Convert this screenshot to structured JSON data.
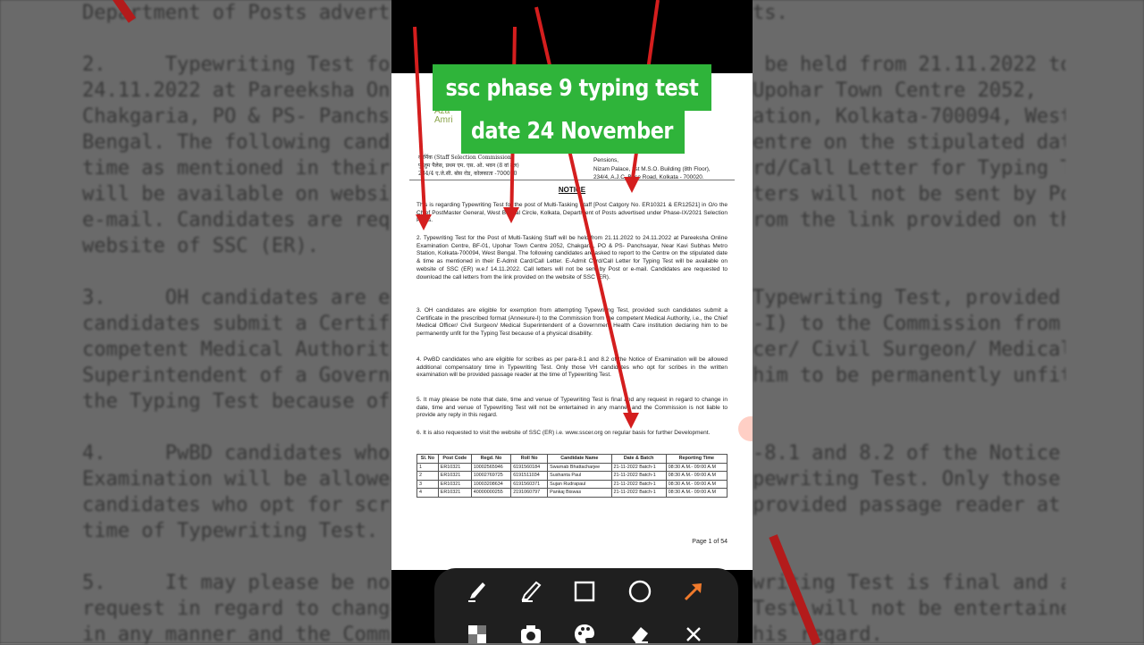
{
  "overlay_title": {
    "line1": "ssc phase 9 typing test",
    "line2": "date 24 November"
  },
  "document": {
    "logo_text": "Aza\nAmri",
    "header_left": [
      "कार्मिक (Staff Selection Commission)",
      "पु.जुम पैलेस, प्रथम एम. एस. ओ. भवन (8 वां तल)",
      "234/4 ए.जे.सी. बोस रोड, कोलकाता -700020"
    ],
    "header_right": [
      "R)",
      "Grievances &",
      "Pensions,",
      "Nizam Palace, 1st M.S.O. Building (8th Floor),",
      "234/4, A.J.C. Bose Road, Kolkata - 700020."
    ],
    "notice_heading": "NOTICE",
    "paragraphs": [
      "This is regarding Typewriting Test for the post of Multi-Tasking Staff [Post Catgory No. ER10321 & ER12521] in O/o the Chief PostMaster General, West Bengal Circle, Kolkata, Department of Posts advertised under Phase-IX/2021 Selection Posts.",
      "2.     Typewriting Test for the Post of Multi-Tasking Staff will be held from 21.11.2022 to 24.11.2022 at Pareeksha Online Examination Centre, BF-01, Upohar Town Centre 2052, Chakgaria, PO & PS- Panchsayar, Near Kavi Subhas Metro Station, Kolkata-700094, West Bengal. The following candidates are asked to report to the Centre on the stipulated date & time as mentioned in their E-Admit Card/Call Letter. E-Admit Card/Call Letter for Typing Test will be available on website of SSC (ER) w.e.f 14.11.2022. Call letters will not be sent by Post or e-mail. Candidates are requested to download the call letters from the link provided on the website of SSC (ER).",
      "3.     OH candidates are eligible for exemption from attempting Typewriting Test, provided such candidates submit a Certificate in the prescribed format (Annexure-I) to the Commission from the competent Medical Authority, i.e., the Chief Medical Officer/ Civil Surgeon/ Medical Superintendent of a Government Health Care institution declaring him to be permanently unfit for the Typing Test because of a physical disability.",
      "4.     PwBD candidates who are eligible for scribes as per para-8.1 and 8.2 of the Notice of Examination will be allowed additional compensatory time in Typewriting Test. Only those VH candidates who opt for scribes in the written examination will be provided passage reader at the time of Typewriting Test.",
      "5.     It may please be note that date, time and venue of Typewriting Test is final and any request in regard to change in date, time and venue of Typewriting Test will not be entertained in any manner and the Commission is not liable to provide any reply in this regard.",
      "6.     It is also requested to visit the website of SSC (ER) i.e. www.sscer.org on regular basis for further Development."
    ],
    "table": {
      "headers": [
        "Sl. No",
        "Post Code",
        "Regd. No",
        "Roll No",
        "Candidate Name",
        "Date & Batch",
        "Reporting Time"
      ],
      "rows": [
        [
          "1",
          "ER10321",
          "10002565946",
          "6191560184",
          "Swarnab Bhattacharjee",
          "21-11-2022 Batch-1",
          "08:30 A.M.- 09:00 A.M"
        ],
        [
          "2",
          "ER10321",
          "10002769725",
          "6191511034",
          "Sushanta Paul",
          "21-11-2022 Batch-1",
          "08:30 A.M.- 09:00 A.M"
        ],
        [
          "3",
          "ER10321",
          "10003208634",
          "6191560371",
          "Sujan Rudrapaul",
          "21-11-2022 Batch-1",
          "08:30 A.M.- 09:00 A.M"
        ],
        [
          "4",
          "ER10321",
          "40000000255",
          "2191060797",
          "Pankaj Biswas",
          "21-11-2022 Batch-1",
          "08:30 A.M.- 09:00 A.M"
        ]
      ]
    },
    "page_label": "Page 1 of 54"
  },
  "background_text": {
    "left": [
      "Department of Posts advertise",
      "",
      "2.     Typewriting Test for",
      "24.11.2022 at Pareeksha Onl",
      "Chakgaria, PO & PS- Panchs",
      "Bengal. The following candidat",
      "time as mentioned in their E-A",
      "will be available on website of",
      "e-mail. Candidates are reques",
      "website of SSC (ER).",
      "",
      "3.     OH candidates are eligible",
      "candidates submit a Certificate",
      "competent Medical Authority",
      "Superintendent of a Governme",
      "the Typing Test because of a ph",
      "",
      "4.     PwBD candidates who a",
      "Examination will be allowed a",
      "candidates who opt for scribes",
      "time of Typewriting Test.",
      "",
      "5.     It may please be note",
      "request in regard to change in",
      "in any manner and the Commiss"
    ],
    "right": [
      "ts.",
      "",
      " be held from 21.11.2022 to",
      "Upohar Town Centre 2052,",
      "ation, Kolkata-700094, West",
      "entre on the stipulated date &",
      "rd/Call Letter for Typing Test",
      "ters will not be sent by Post or",
      "rom the link provided on the",
      "",
      "",
      "Typewriting Test, provided such",
      "-I) to the Commission from the",
      "cer/ Civil Surgeon/ Medical",
      "him to be permanently unfit for",
      "",
      "",
      "-8.1 and 8.2 of the Notice of",
      "pewriting Test. Only those VH",
      "provided passage reader at the",
      "",
      "",
      "writing Test is final and any",
      "Test will not be entertained",
      "his regard."
    ]
  },
  "toolbar": {
    "tools": [
      "marker-tool",
      "highlighter-tool",
      "rectangle-tool",
      "circle-tool",
      "arrow-tool",
      "mosaic-tool",
      "screenshot-tool",
      "color-palette-tool",
      "eraser-tool",
      "close-tool"
    ],
    "active_color": "#f07a2c"
  },
  "colors": {
    "title_bg": "#2fb43a",
    "arrow": "#d41e1e"
  }
}
